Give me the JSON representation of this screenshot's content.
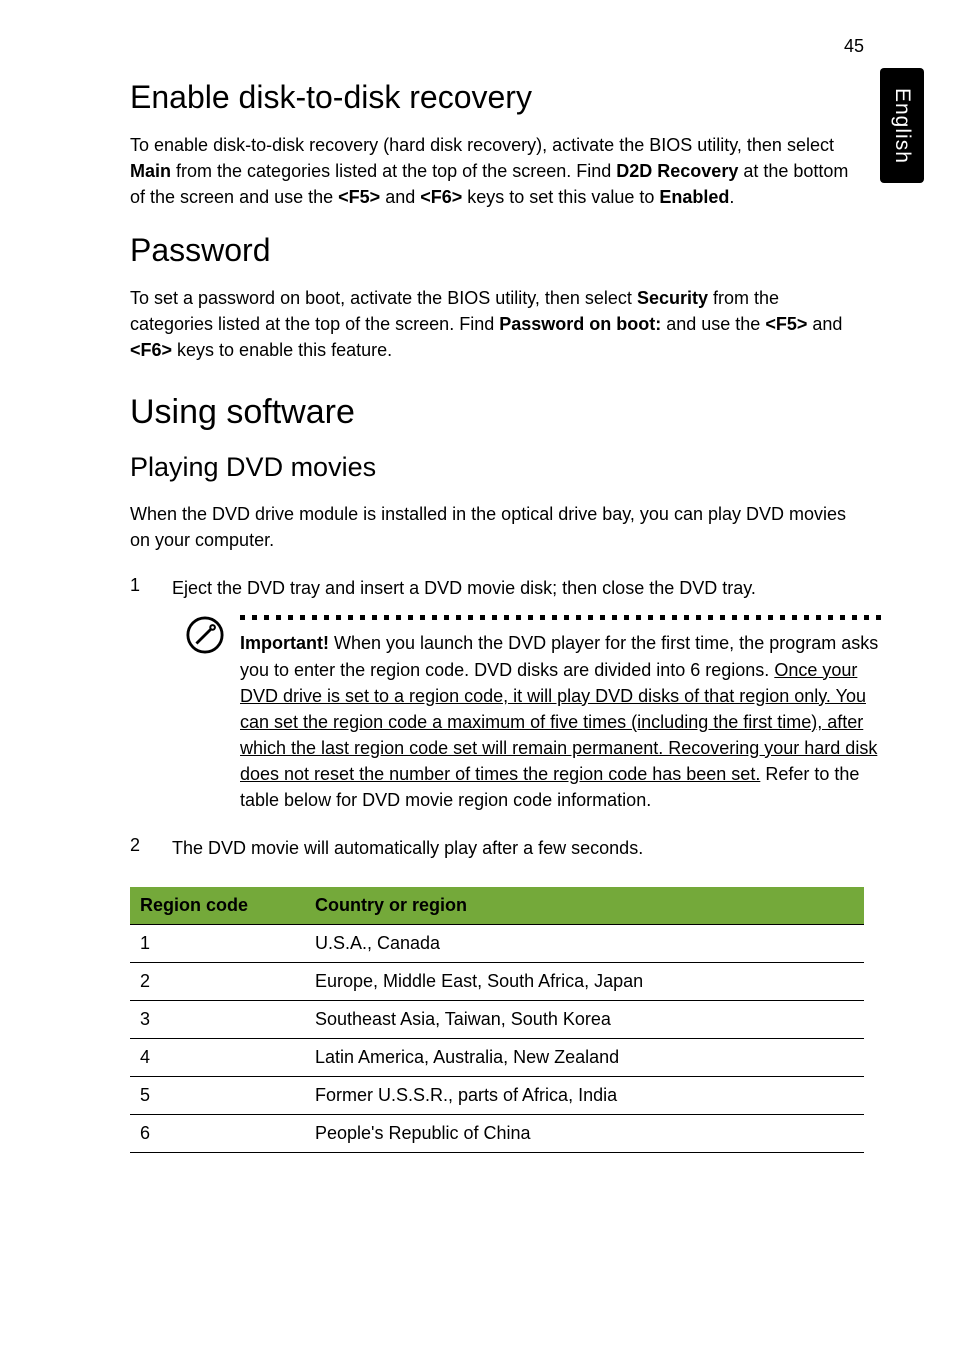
{
  "pagenum": "45",
  "sidetab": "English",
  "h_d2d": "Enable disk-to-disk recovery",
  "p_d2d_1": "To enable disk-to-disk recovery (hard disk recovery), activate the BIOS utility, then select ",
  "p_d2d_b1": "Main",
  "p_d2d_2": " from the categories listed at the top of the screen. Find ",
  "p_d2d_b2": "D2D Recovery",
  "p_d2d_3": " at the bottom of the screen and use the ",
  "p_d2d_b3": "<F5>",
  "p_d2d_4": " and ",
  "p_d2d_b4": "<F6>",
  "p_d2d_5": " keys to set this value to ",
  "p_d2d_b5": "Enabled",
  "p_d2d_6": ".",
  "h_pw": "Password",
  "p_pw_1": "To set a password on boot, activate the BIOS utility, then select ",
  "p_pw_b1": "Security",
  "p_pw_2": " from the categories listed at the top of the screen. Find ",
  "p_pw_b2": "Password on boot:",
  "p_pw_3": " and use the ",
  "p_pw_b3": "<F5>",
  "p_pw_4": " and ",
  "p_pw_b4": "<F6>",
  "p_pw_5": " keys to enable this feature.",
  "h_sw": "Using software",
  "h_dvd": "Playing DVD movies",
  "p_dvd_intro": "When the DVD drive module is installed in the optical drive bay, you can play DVD movies on your computer.",
  "step1_num": "1",
  "step1_text": "Eject the DVD tray and insert a DVD movie disk; then close the DVD tray.",
  "note": {
    "b1": "Important!",
    "t1": " When you launch the DVD player for the first time, the program asks you to enter the region code. DVD disks are divided into 6 regions. ",
    "u1": "Once your DVD drive is set to a region code, it will play DVD disks of that region only. You can set the region code a maximum of five times (including the first time), after which the last region code set will remain permanent. Recovering your hard disk does not reset the number of times the region code has been set.",
    "t2": " Refer to the table below for DVD movie region code information."
  },
  "step2_num": "2",
  "step2_text": "The DVD movie will automatically play after a few seconds.",
  "table": {
    "h1": "Region code",
    "h2": "Country or region",
    "rows": [
      {
        "c1": "1",
        "c2": "U.S.A., Canada"
      },
      {
        "c1": "2",
        "c2": "Europe, Middle East, South Africa, Japan"
      },
      {
        "c1": "3",
        "c2": "Southeast Asia, Taiwan, South Korea"
      },
      {
        "c1": "4",
        "c2": "Latin America, Australia, New Zealand"
      },
      {
        "c1": "5",
        "c2": "Former U.S.S.R., parts of Africa, India"
      },
      {
        "c1": "6",
        "c2": "People's Republic of China"
      }
    ]
  }
}
